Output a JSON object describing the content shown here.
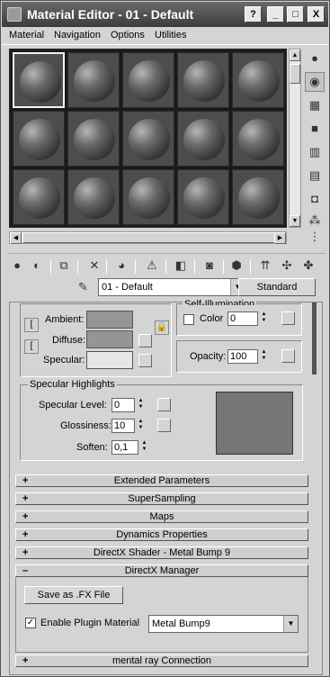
{
  "window": {
    "title": "Material Editor - 01 - Default",
    "buttons": {
      "question": "?",
      "minimize": "_",
      "maximize": "□",
      "close": "X"
    }
  },
  "menu": [
    "Material",
    "Navigation",
    "Options",
    "Utilities"
  ],
  "slots": {
    "rows": 3,
    "cols": 5,
    "active_index": 0
  },
  "side_tools": [
    "sample-type-icon",
    "backlight-icon",
    "background-icon",
    "sample-uv-tiling-icon",
    "video-color-check-icon",
    "make-preview-icon",
    "options-icon",
    "select-by-material-icon",
    "material-map-navigator-icon"
  ],
  "toolbar_icons": [
    "get-material-icon",
    "put-material-icon",
    "assign-material-icon",
    "reset-map-icon",
    "make-unique-icon",
    "put-library-icon",
    "material-id-channel-icon",
    "show-map-icon",
    "show-end-result-icon",
    "go-to-parent-icon",
    "go-forward-icon"
  ],
  "name_row": {
    "material_name": "01 - Default",
    "type_button": "Standard"
  },
  "basic": {
    "self_illumination_label": "Self-Illumination",
    "ambient": "Ambient:",
    "diffuse": "Diffuse:",
    "specular": "Specular:",
    "color_label": "Color",
    "color_value": "0",
    "opacity_label": "Opacity:",
    "opacity_value": "100",
    "colors": {
      "ambient": "#959595",
      "diffuse": "#959595",
      "specular": "#e6e6e6"
    }
  },
  "specular_highlights": {
    "title": "Specular Highlights",
    "level_label": "Specular Level:",
    "level_value": "0",
    "gloss_label": "Glossiness:",
    "gloss_value": "10",
    "soften_label": "Soften:",
    "soften_value": "0,1"
  },
  "rollouts": [
    {
      "sign": "+",
      "label": "Extended Parameters"
    },
    {
      "sign": "+",
      "label": "SuperSampling"
    },
    {
      "sign": "+",
      "label": "Maps"
    },
    {
      "sign": "+",
      "label": "Dynamics Properties"
    },
    {
      "sign": "+",
      "label": "DirectX Shader - Metal Bump 9"
    },
    {
      "sign": "–",
      "label": "DirectX Manager"
    }
  ],
  "directx_manager": {
    "save_button": "Save as .FX File",
    "enable_label": "Enable Plugin Material",
    "enable_checked": "✓",
    "plugin_value": "Metal Bump9"
  },
  "last_rollout": {
    "sign": "+",
    "label": "mental ray Connection"
  }
}
